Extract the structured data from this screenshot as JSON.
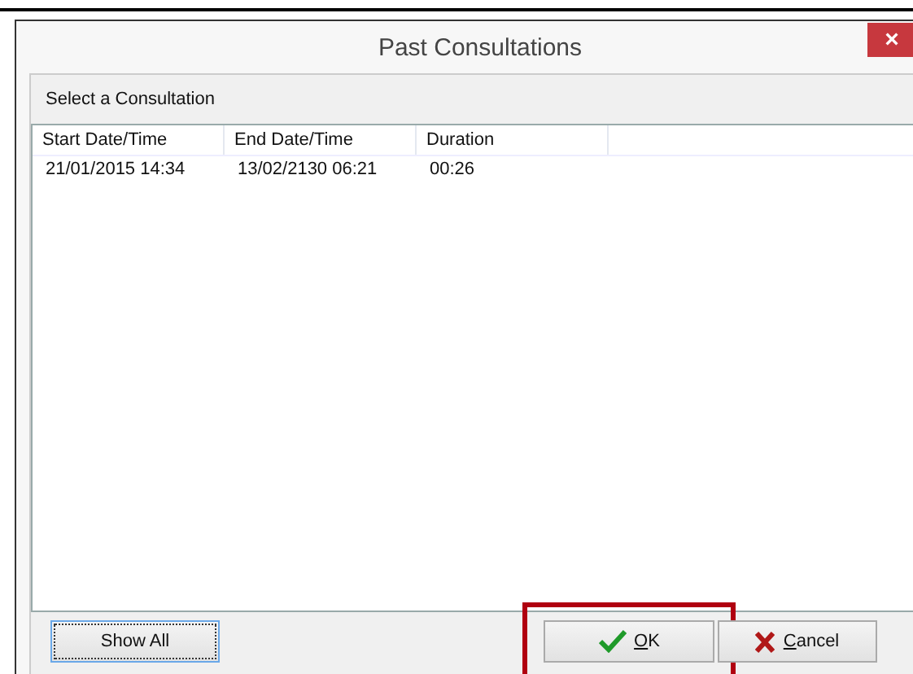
{
  "window": {
    "title": "Past Consultations",
    "close": "×"
  },
  "panel": {
    "heading": "Select a Consultation"
  },
  "table": {
    "columns": [
      "Start Date/Time",
      "End Date/Time",
      "Duration"
    ],
    "rows": [
      {
        "cells": [
          "21/01/2015 14:34",
          "13/02/2130 06:21",
          "00:26"
        ],
        "selected": false
      }
    ]
  },
  "buttons": [
    {
      "label": "Show All",
      "kind": "plain",
      "highlighted": false
    },
    {
      "label": "OK",
      "kind": "ok",
      "highlighted": true
    },
    {
      "label": "Cancel",
      "kind": "cancel",
      "highlighted": false
    }
  ]
}
